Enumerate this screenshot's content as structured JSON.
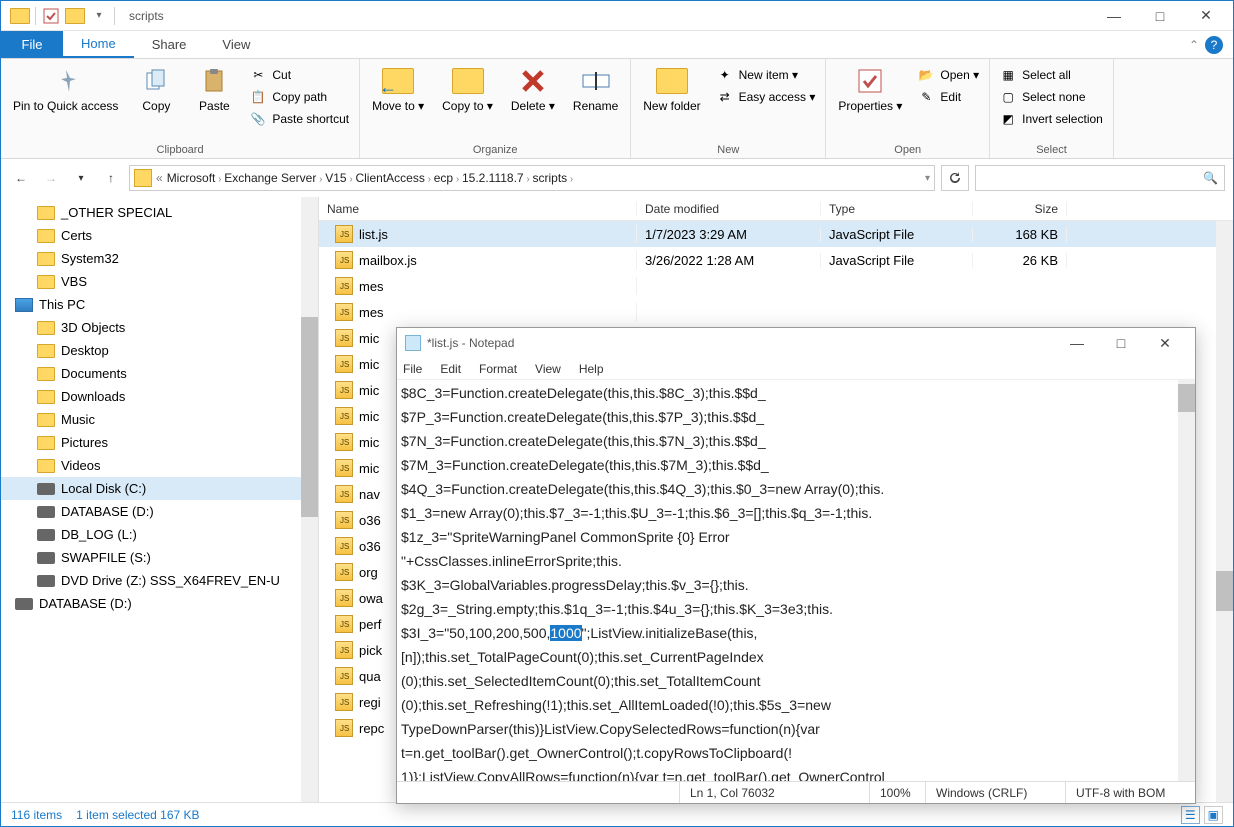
{
  "titlebar": {
    "app_title": "scripts"
  },
  "win_controls": {
    "min": "—",
    "max": "□",
    "close": "✕"
  },
  "tabs": {
    "file": "File",
    "home": "Home",
    "share": "Share",
    "view": "View"
  },
  "ribbon": {
    "clipboard": {
      "label": "Clipboard",
      "pin": "Pin to Quick access",
      "copy": "Copy",
      "paste": "Paste",
      "cut": "Cut",
      "copy_path": "Copy path",
      "paste_shortcut": "Paste shortcut"
    },
    "organize": {
      "label": "Organize",
      "move_to": "Move to ▾",
      "copy_to": "Copy to ▾",
      "delete": "Delete ▾",
      "rename": "Rename"
    },
    "new": {
      "label": "New",
      "new_folder": "New folder",
      "new_item": "New item ▾",
      "easy_access": "Easy access ▾"
    },
    "open": {
      "label": "Open",
      "properties": "Properties ▾",
      "open": "Open ▾",
      "edit": "Edit"
    },
    "select": {
      "label": "Select",
      "select_all": "Select all",
      "select_none": "Select none",
      "invert": "Invert selection"
    }
  },
  "breadcrumb": {
    "start": "«",
    "items": [
      "Microsoft",
      "Exchange Server",
      "V15",
      "ClientAccess",
      "ecp",
      "15.2.1118.7",
      "scripts"
    ]
  },
  "tree": {
    "nodes": [
      {
        "label": "_OTHER SPECIAL",
        "type": "folder",
        "lvl": 1
      },
      {
        "label": "Certs",
        "type": "folder",
        "lvl": 1
      },
      {
        "label": "System32",
        "type": "folder",
        "lvl": 1
      },
      {
        "label": "VBS",
        "type": "folder",
        "lvl": 1
      },
      {
        "label": "This PC",
        "type": "pc",
        "lvl": 0
      },
      {
        "label": "3D Objects",
        "type": "folder",
        "lvl": 1
      },
      {
        "label": "Desktop",
        "type": "folder",
        "lvl": 1
      },
      {
        "label": "Documents",
        "type": "folder",
        "lvl": 1
      },
      {
        "label": "Downloads",
        "type": "folder",
        "lvl": 1
      },
      {
        "label": "Music",
        "type": "folder",
        "lvl": 1
      },
      {
        "label": "Pictures",
        "type": "folder",
        "lvl": 1
      },
      {
        "label": "Videos",
        "type": "folder",
        "lvl": 1
      },
      {
        "label": "Local Disk (C:)",
        "type": "drive",
        "lvl": 1,
        "selected": true
      },
      {
        "label": "DATABASE (D:)",
        "type": "drive",
        "lvl": 1
      },
      {
        "label": "DB_LOG (L:)",
        "type": "drive",
        "lvl": 1
      },
      {
        "label": "SWAPFILE (S:)",
        "type": "drive",
        "lvl": 1
      },
      {
        "label": "DVD Drive (Z:) SSS_X64FREV_EN-U",
        "type": "drive",
        "lvl": 1
      },
      {
        "label": "DATABASE (D:)",
        "type": "drive",
        "lvl": 0
      }
    ]
  },
  "listhead": {
    "name": "Name",
    "date": "Date modified",
    "type": "Type",
    "size": "Size"
  },
  "files": [
    {
      "name": "list.js",
      "date": "1/7/2023 3:29 AM",
      "type": "JavaScript File",
      "size": "168 KB",
      "selected": true
    },
    {
      "name": "mailbox.js",
      "date": "3/26/2022 1:28 AM",
      "type": "JavaScript File",
      "size": "26 KB"
    },
    {
      "name": "mes",
      "date": "",
      "type": "",
      "size": ""
    },
    {
      "name": "mes",
      "date": "",
      "type": "",
      "size": ""
    },
    {
      "name": "mic",
      "date": "",
      "type": "",
      "size": ""
    },
    {
      "name": "mic",
      "date": "",
      "type": "",
      "size": ""
    },
    {
      "name": "mic",
      "date": "",
      "type": "",
      "size": ""
    },
    {
      "name": "mic",
      "date": "",
      "type": "",
      "size": ""
    },
    {
      "name": "mic",
      "date": "",
      "type": "",
      "size": ""
    },
    {
      "name": "mic",
      "date": "",
      "type": "",
      "size": ""
    },
    {
      "name": "nav",
      "date": "",
      "type": "",
      "size": ""
    },
    {
      "name": "o36",
      "date": "",
      "type": "",
      "size": ""
    },
    {
      "name": "o36",
      "date": "",
      "type": "",
      "size": ""
    },
    {
      "name": "org",
      "date": "",
      "type": "",
      "size": ""
    },
    {
      "name": "owa",
      "date": "",
      "type": "",
      "size": ""
    },
    {
      "name": "perf",
      "date": "",
      "type": "",
      "size": ""
    },
    {
      "name": "pick",
      "date": "",
      "type": "",
      "size": ""
    },
    {
      "name": "qua",
      "date": "",
      "type": "",
      "size": ""
    },
    {
      "name": "regi",
      "date": "",
      "type": "",
      "size": ""
    },
    {
      "name": "repc",
      "date": "",
      "type": "",
      "size": ""
    }
  ],
  "statusbar": {
    "items": "116 items",
    "selected": "1 item selected  167 KB"
  },
  "notepad": {
    "title": "*list.js - Notepad",
    "menu": {
      "file": "File",
      "edit": "Edit",
      "format": "Format",
      "view": "View",
      "help": "Help"
    },
    "lines_before_sel": "$8C_3=Function.createDelegate(this,this.$8C_3);this.$$d_\n$7P_3=Function.createDelegate(this,this.$7P_3);this.$$d_\n$7N_3=Function.createDelegate(this,this.$7N_3);this.$$d_\n$7M_3=Function.createDelegate(this,this.$7M_3);this.$$d_\n$4Q_3=Function.createDelegate(this,this.$4Q_3);this.$0_3=new Array(0);this.\n$1_3=new Array(0);this.$7_3=-1;this.$U_3=-1;this.$6_3=[];this.$q_3=-1;this.\n$1z_3=\"SpriteWarningPanel CommonSprite {0} Error\n\"+CssClasses.inlineErrorSprite;this.\n$3K_3=GlobalVariables.progressDelay;this.$v_3={};this.\n$2g_3=_String.empty;this.$1q_3=-1;this.$4u_3={};this.$K_3=3e3;this.\n$3I_3=\"50,100,200,500,",
    "selection": "1000",
    "lines_after_sel": "\";ListView.initializeBase(this,\n[n]);this.set_TotalPageCount(0);this.set_CurrentPageIndex\n(0);this.set_SelectedItemCount(0);this.set_TotalItemCount\n(0);this.set_Refreshing(!1);this.set_AllItemLoaded(!0);this.$5s_3=new\nTypeDownParser(this)}ListView.CopySelectedRows=function(n){var\nt=n.get_toolBar().get_OwnerControl();t.copyRowsToClipboard(!\n1)};ListView.CopyAllRows=function(n){var t=n.get_toolBar().get_OwnerControl",
    "status": {
      "pos": "Ln 1, Col 76032",
      "zoom": "100%",
      "eol": "Windows (CRLF)",
      "enc": "UTF-8 with BOM"
    }
  }
}
